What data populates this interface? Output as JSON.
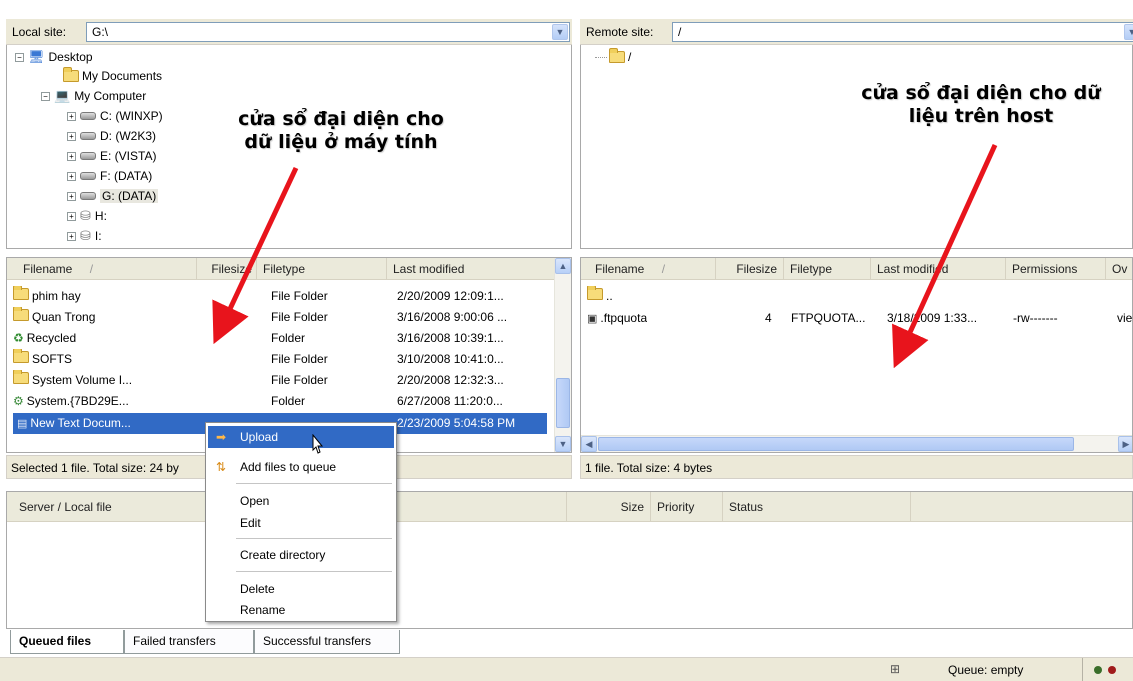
{
  "local": {
    "site_label": "Local site:",
    "site_value": "G:\\",
    "tree": [
      {
        "label": "Desktop",
        "icon": "desktop-icon"
      },
      {
        "label": "My Documents",
        "icon": "folder-icon"
      },
      {
        "label": "My Computer",
        "icon": "computer-icon"
      },
      {
        "label": "C: (WINXP)",
        "icon": "drive-icon"
      },
      {
        "label": "D: (W2K3)",
        "icon": "drive-icon"
      },
      {
        "label": "E: (VISTA)",
        "icon": "drive-icon"
      },
      {
        "label": "F: (DATA)",
        "icon": "drive-icon"
      },
      {
        "label": "G: (DATA)",
        "icon": "drive-icon"
      },
      {
        "label": "H:",
        "icon": "network-drive-icon"
      },
      {
        "label": "I:",
        "icon": "network-drive-icon"
      }
    ],
    "columns": {
      "filename": "Filename",
      "sort": "/",
      "filesize": "Filesize",
      "filetype": "Filetype",
      "modified": "Last modified"
    },
    "files": [
      {
        "name": "phim hay",
        "type": "File Folder",
        "modified": "2/20/2009 12:09:1...",
        "icon": "folder-icon"
      },
      {
        "name": "Quan Trong",
        "type": "File Folder",
        "modified": "3/16/2008 9:00:06 ...",
        "icon": "folder-icon"
      },
      {
        "name": "Recycled",
        "type": "Folder",
        "modified": "3/16/2008 10:39:1...",
        "icon": "recycle-icon"
      },
      {
        "name": "SOFTS",
        "type": "File Folder",
        "modified": "3/10/2008 10:41:0...",
        "icon": "folder-icon"
      },
      {
        "name": "System Volume I...",
        "type": "File Folder",
        "modified": "2/20/2008 12:32:3...",
        "icon": "folder-icon"
      },
      {
        "name": "System.{7BD29E...",
        "type": "Folder",
        "modified": "6/27/2008 11:20:0...",
        "icon": "special-folder-icon"
      },
      {
        "name": "New Text Docum...",
        "type": "",
        "modified": "2/23/2009 5:04:58 PM",
        "icon": "text-file-icon"
      }
    ],
    "status": "Selected 1 file. Total size: 24 by"
  },
  "remote": {
    "site_label": "Remote site:",
    "site_value": "/",
    "tree_root": "/",
    "columns": {
      "filename": "Filename",
      "sort": "/",
      "filesize": "Filesize",
      "filetype": "Filetype",
      "modified": "Last modified",
      "permissions": "Permissions",
      "owner": "Ov"
    },
    "files": [
      {
        "name": "..",
        "size": "",
        "type": "",
        "modified": "",
        "permissions": "",
        "owner": "",
        "icon": "folder-icon"
      },
      {
        "name": ".ftpquota",
        "size": "4",
        "type": "FTPQUOTA...",
        "modified": "3/18/2009 1:33...",
        "permissions": "-rw-------",
        "owner": "vie",
        "icon": "file-icon"
      }
    ],
    "status": "1 file. Total size: 4 bytes"
  },
  "annotations": {
    "local_line1": "cửa sổ đại diện cho",
    "local_line2": "dữ liệu ở máy tính",
    "remote_line1": "cửa sổ đại diện cho dữ",
    "remote_line2": "liệu trên host"
  },
  "queue": {
    "col_server": "Server / Local file",
    "col_size": "Size",
    "col_priority": "Priority",
    "col_status": "Status"
  },
  "context_menu": {
    "upload": "Upload",
    "add_queue": "Add files to queue",
    "open": "Open",
    "edit": "Edit",
    "create_dir": "Create directory",
    "delete": "Delete",
    "rename": "Rename"
  },
  "tabs": {
    "queued": "Queued files",
    "failed": "Failed transfers",
    "successful": "Successful transfers"
  },
  "statusbar": {
    "queue": "Queue: empty"
  },
  "colors": {
    "selection": "#316ac5",
    "arrow": "#e8141c",
    "toolbar": "#ece9d8"
  }
}
